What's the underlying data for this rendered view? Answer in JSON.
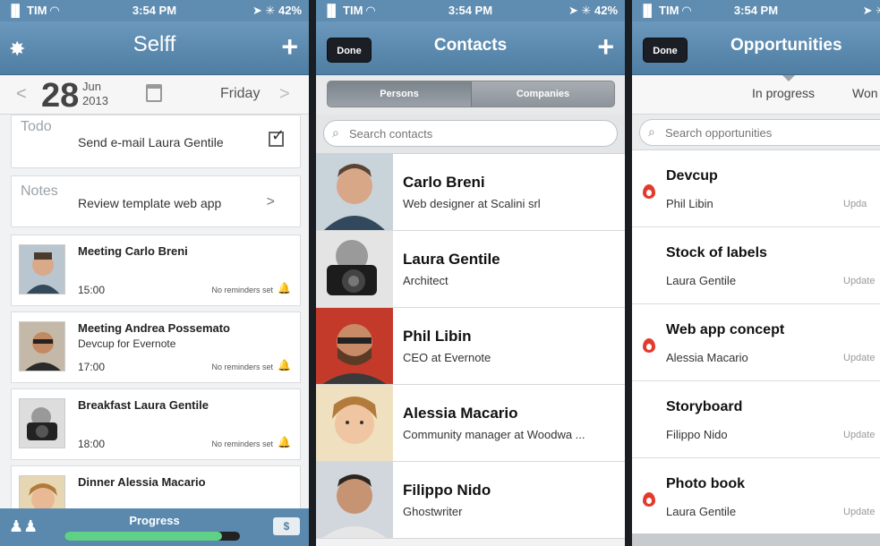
{
  "status": {
    "carrier": "▐▌ TIM ◠",
    "time": "3:54 PM",
    "battery_p1": "➤ ✳ 42%",
    "battery_p2": "➤ ✳ 42%",
    "battery_p3": "➤ ✳"
  },
  "selff": {
    "title": "Selff",
    "date": {
      "day": "28",
      "month": "Jun",
      "year": "2013",
      "weekday": "Friday"
    },
    "todo": {
      "label": "Todo",
      "text": "Send e-mail Laura Gentile"
    },
    "notes": {
      "label": "Notes",
      "text": "Review template web app"
    },
    "events": [
      {
        "title": "Meeting Carlo Breni",
        "subtitle": "",
        "time": "15:00",
        "reminder": "No reminders set"
      },
      {
        "title": "Meeting Andrea Possemato",
        "subtitle": "Devcup for Evernote",
        "time": "17:00",
        "reminder": "No reminders set"
      },
      {
        "title": "Breakfast Laura Gentile",
        "subtitle": "",
        "time": "18:00",
        "reminder": "No reminders set"
      },
      {
        "title": "Dinner Alessia Macario",
        "subtitle": "",
        "time": "",
        "reminder": ""
      }
    ],
    "bottom": {
      "progress_label": "Progress",
      "progress_value": 0.9,
      "dollar": "$"
    }
  },
  "contacts": {
    "done": "Done",
    "title": "Contacts",
    "segments": [
      "Persons",
      "Companies"
    ],
    "search_placeholder": "Search contacts",
    "list": [
      {
        "name": "Carlo Breni",
        "role": "Web designer at Scalini srl"
      },
      {
        "name": "Laura Gentile",
        "role": "Architect"
      },
      {
        "name": "Phil Libin",
        "role": "CEO at Evernote"
      },
      {
        "name": "Alessia Macario",
        "role": "Community manager at Woodwa ..."
      },
      {
        "name": "Filippo Nido",
        "role": "Ghostwriter"
      }
    ]
  },
  "opportunities": {
    "done": "Done",
    "title": "Opportunities",
    "filters": [
      "In progress",
      "Won"
    ],
    "search_placeholder": "Search opportunities",
    "list": [
      {
        "title": "Devcup",
        "owner": "Phil Libin",
        "updated": "Upda",
        "hot": true
      },
      {
        "title": "Stock of labels",
        "owner": "Laura Gentile",
        "updated": "Update",
        "hot": false
      },
      {
        "title": "Web app concept",
        "owner": "Alessia Macario",
        "updated": "Update",
        "hot": true
      },
      {
        "title": "Storyboard",
        "owner": "Filippo Nido",
        "updated": "Update",
        "hot": false
      },
      {
        "title": "Photo book",
        "owner": "Laura Gentile",
        "updated": "Update",
        "hot": true
      }
    ]
  },
  "colors": {
    "nav": "#5f8db1",
    "progress_fill": "#5fd186",
    "hot": "#e23b2e"
  }
}
